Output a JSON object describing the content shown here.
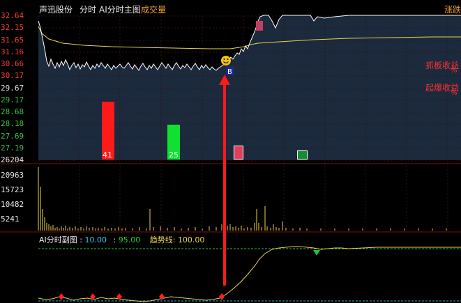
{
  "header": {
    "stock_name": "声迅股份",
    "tab_intraday": "分时",
    "tab_ai_main": "AI分时主图",
    "tab_volume": "成交量",
    "right_label": "涨跌"
  },
  "price_axis": {
    "labels": [
      "32.64",
      "32.15",
      "31.65",
      "31.16",
      "30.66",
      "30.17",
      "29.67",
      "29.17",
      "28.68",
      "28.18",
      "27.69",
      "27.19"
    ],
    "colors": [
      "#ff3b3b",
      "#ff3b3b",
      "#ff3b3b",
      "#ff3b3b",
      "#ff3b3b",
      "#ff3b3b",
      "#e0e0e0",
      "#2ecc40",
      "#2ecc40",
      "#2ecc40",
      "#2ecc40",
      "#2ecc40"
    ]
  },
  "volume_axis": {
    "labels": [
      "26204",
      "20963",
      "15723",
      "10482",
      "5241"
    ]
  },
  "right_annotations": {
    "line1": "抓板收益",
    "line1_sub": "%",
    "line2": "起爆收益",
    "line2_sub": "%"
  },
  "bars": {
    "red_value": "41",
    "green_value": "25"
  },
  "sub_panel": {
    "title": "AI分时副图",
    "sep1": ":",
    "value1": "10.00",
    "sep2": ":",
    "value2": "95.00",
    "trend_label": "趋势线",
    "sep3": ":",
    "trend_value": "100.00"
  },
  "signals": {
    "buy_mark": "B",
    "smile": "☺"
  },
  "colors": {
    "background": "#000000",
    "price_line": "#ffffff",
    "avg_line": "#e8d44d",
    "fill": "#1b2a3d",
    "red": "#ff2020",
    "green": "#20ff40",
    "volume": "#e8d44d",
    "grid": "#3a1010"
  }
}
